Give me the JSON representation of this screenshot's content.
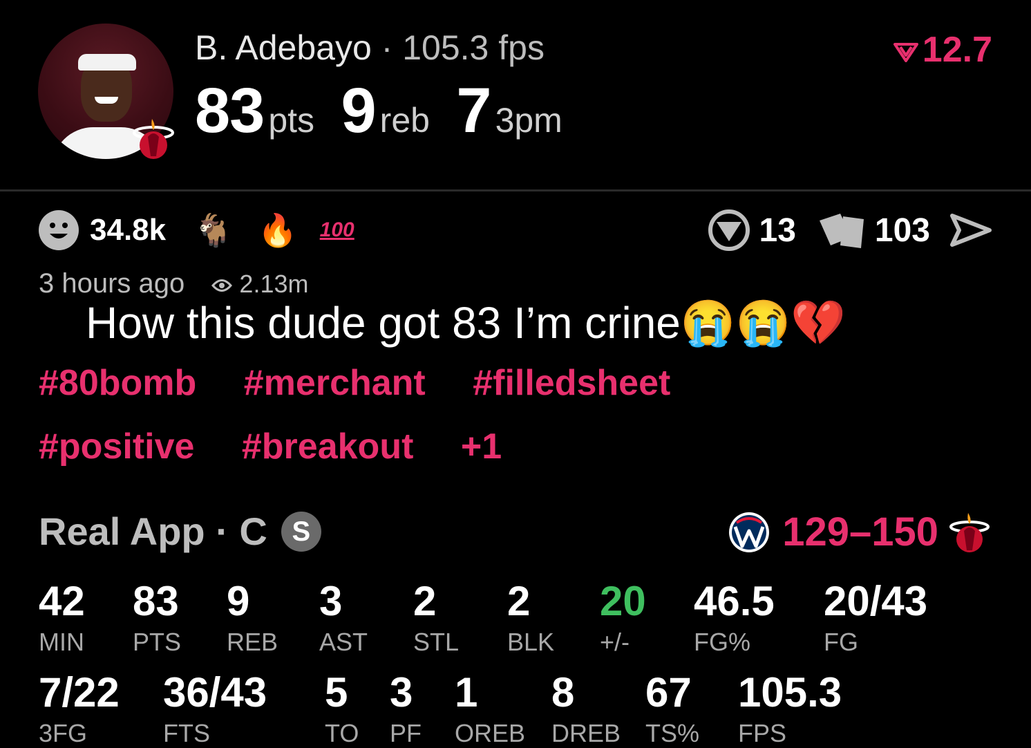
{
  "header": {
    "player_name": "B. Adebayo",
    "separator": "·",
    "fps": "105.3 fps",
    "rating": "12.7",
    "pts": "83",
    "pts_unit": "pts",
    "reb": "9",
    "reb_unit": "reb",
    "tpm": "7",
    "tpm_unit": "3pm"
  },
  "reactions": {
    "count": "34.8k",
    "goat_emoji": "🐐",
    "fire_emoji": "🔥",
    "hundred_emoji": "100"
  },
  "actions": {
    "rating_count": "13",
    "cards_count": "103"
  },
  "meta": {
    "time": "3 hours ago",
    "views": "2.13m"
  },
  "caption": "How this dude got 83 I’m crine😭😭💔",
  "tags": [
    "#80bomb",
    "#merchant",
    "#filledsheet",
    "#positive",
    "#breakout",
    "+1"
  ],
  "game": {
    "source": "Real App · C",
    "badge": "S",
    "score": "129–150"
  },
  "stats_row1": [
    {
      "value": "42",
      "label": "MIN"
    },
    {
      "value": "83",
      "label": "PTS"
    },
    {
      "value": "9",
      "label": "REB"
    },
    {
      "value": "3",
      "label": "AST"
    },
    {
      "value": "2",
      "label": "STL"
    },
    {
      "value": "2",
      "label": "BLK"
    },
    {
      "value": "20",
      "label": "+/-"
    },
    {
      "value": "46.5",
      "label": "FG%"
    },
    {
      "value": "20/43",
      "label": "FG"
    }
  ],
  "stats_row2": [
    {
      "value": "7/22",
      "label": "3FG"
    },
    {
      "value": "36/43",
      "label": "FTS"
    },
    {
      "value": "5",
      "label": "TO"
    },
    {
      "value": "3",
      "label": "PF"
    },
    {
      "value": "1",
      "label": "OREB"
    },
    {
      "value": "8",
      "label": "DREB"
    },
    {
      "value": "67",
      "label": "TS%"
    },
    {
      "value": "105.3",
      "label": "FPS"
    }
  ],
  "colors": {
    "accent": "#e8306e",
    "positive": "#3fbf5f",
    "background": "#000000"
  }
}
